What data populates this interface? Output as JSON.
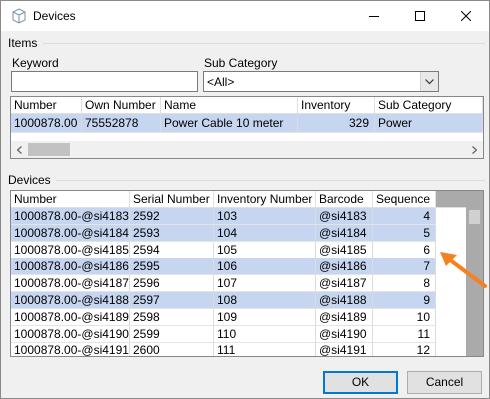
{
  "window": {
    "title": "Devices",
    "icon": "cube-icon"
  },
  "items_group": {
    "label": "Items",
    "keyword_label": "Keyword",
    "keyword_value": "",
    "subcategory_label": "Sub Category",
    "subcategory_value": "<All>",
    "columns": [
      "Number",
      "Own Number",
      "Name",
      "Inventory",
      "Sub Category"
    ],
    "rows": [
      {
        "number": "1000878.00",
        "own_number": "75552878",
        "name": "Power Cable 10 meter",
        "inventory": "329",
        "sub_category": "Power"
      }
    ]
  },
  "devices_group": {
    "label": "Devices",
    "columns": [
      "Number",
      "Serial Number",
      "Inventory Number",
      "Barcode",
      "Sequence"
    ],
    "rows": [
      {
        "number": "1000878.00-@si4183",
        "serial": "2592",
        "inventory": "103",
        "barcode": "@si4183",
        "sequence": "4",
        "selected": true
      },
      {
        "number": "1000878.00-@si4184",
        "serial": "2593",
        "inventory": "104",
        "barcode": "@si4184",
        "sequence": "5",
        "selected": true
      },
      {
        "number": "1000878.00-@si4185",
        "serial": "2594",
        "inventory": "105",
        "barcode": "@si4185",
        "sequence": "6",
        "selected": false
      },
      {
        "number": "1000878.00-@si4186",
        "serial": "2595",
        "inventory": "106",
        "barcode": "@si4186",
        "sequence": "7",
        "selected": true
      },
      {
        "number": "1000878.00-@si4187",
        "serial": "2596",
        "inventory": "107",
        "barcode": "@si4187",
        "sequence": "8",
        "selected": false
      },
      {
        "number": "1000878.00-@si4188",
        "serial": "2597",
        "inventory": "108",
        "barcode": "@si4188",
        "sequence": "9",
        "selected": true
      },
      {
        "number": "1000878.00-@si4189",
        "serial": "2598",
        "inventory": "109",
        "barcode": "@si4189",
        "sequence": "10",
        "selected": false
      },
      {
        "number": "1000878.00-@si4190",
        "serial": "2599",
        "inventory": "110",
        "barcode": "@si4190",
        "sequence": "11",
        "selected": false
      },
      {
        "number": "1000878.00-@si4191",
        "serial": "2600",
        "inventory": "111",
        "barcode": "@si4191",
        "sequence": "12",
        "selected": false
      }
    ]
  },
  "buttons": {
    "ok": "OK",
    "cancel": "Cancel"
  },
  "colors": {
    "selection": "#c6d5f0",
    "annotation_arrow": "#f58220",
    "scrollbar_track": "#aaaaaa"
  }
}
